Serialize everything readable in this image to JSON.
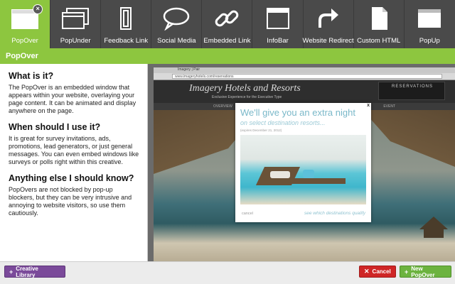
{
  "toolbar": {
    "items": [
      {
        "label": "PopOver",
        "icon": "popover-icon"
      },
      {
        "label": "PopUnder",
        "icon": "popunder-icon"
      },
      {
        "label": "Feedback Link",
        "icon": "feedback-link-icon"
      },
      {
        "label": "Social Media",
        "icon": "speech-bubble-icon"
      },
      {
        "label": "Embedded Link",
        "icon": "chain-link-icon"
      },
      {
        "label": "InfoBar",
        "icon": "infobar-icon"
      },
      {
        "label": "Website Redirect",
        "icon": "redirect-arrow-icon"
      },
      {
        "label": "Custom HTML",
        "icon": "document-icon"
      },
      {
        "label": "PopUp",
        "icon": "popup-window-icon"
      }
    ],
    "close_glyph": "×"
  },
  "header": {
    "title": "PopOver"
  },
  "info": {
    "sections": [
      {
        "heading": "What is it?",
        "body": "The PopOver is an embedded window that appears within your website, overlaying your page content. It can be animated and display anywhere on the page."
      },
      {
        "heading": "When should I use it?",
        "body": "It is great for survey invitations, ads, promotions, lead generators, or just general messages. You can even embed windows like surveys or polls right within this creative."
      },
      {
        "heading": "Anything else I should know?",
        "body": "PopOvers are not blocked by pop-up blockers, but they can be very intrusive and annoying to website visitors, so use them cautiously."
      }
    ]
  },
  "preview": {
    "browser_tab": "Imagery | Pair",
    "url": "www.imageryhotels.com/reservations",
    "site_logo": "Imagery Hotels and Resorts",
    "site_tagline": "Exclusive Experience for the Executive Type",
    "reservations_label": "RESERVATIONS",
    "nav_left": "OVERVIEW",
    "nav_right": "EVENT",
    "popover": {
      "close": "x",
      "headline": "We'll give you an extra night",
      "subline": "on select destination resorts...",
      "expires": "(expires December 21, 2012)",
      "cancel": "cancel",
      "link": "see which destinations qualify"
    }
  },
  "bottom": {
    "library_label": "Creative Library",
    "cancel_label": "Cancel",
    "new_label": "New PopOver"
  },
  "colors": {
    "accent_green": "#8dc63f",
    "toolbar_gray": "#4a4a4a",
    "library_purple": "#7b4a9a",
    "cancel_red": "#cf2626",
    "new_green": "#6cb33f"
  }
}
